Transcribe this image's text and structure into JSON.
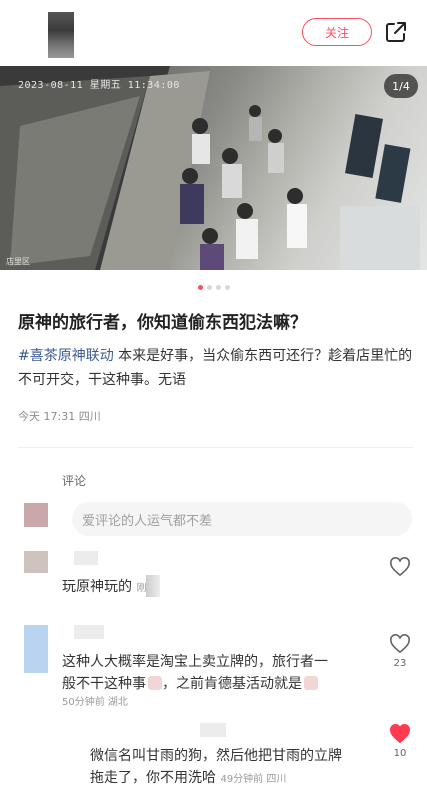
{
  "header": {
    "follow_label": "关注",
    "share_icon": "share-external-icon"
  },
  "photo": {
    "timestamp": "2023-08-11 星期五 11:34:00",
    "counter": "1/4",
    "cam_tag": "店里区",
    "dots_total": 4,
    "dots_active": 1
  },
  "post": {
    "title": "原神的旅行者，你知道偷东西犯法嘛？",
    "hashtag": "#喜茶原神联动",
    "body": " 本来是好事，当众偷东西可还行？趁着店里忙的不可开交，干这种事。无语",
    "meta": "今天 17:31 四川"
  },
  "comments": {
    "label": "评论",
    "input_placeholder": "爱评论的人运气都不差",
    "items": [
      {
        "text": "玩原神玩的",
        "suffix": "刚",
        "likes": "",
        "liked": false
      },
      {
        "text_line1": "这种人大概率是淘宝上卖立牌的，旅行者一",
        "text_line2a": "般不干这种事",
        "text_line2b": "，之前肯德基活动就是",
        "time": "50分钟前 湖北",
        "likes": "23",
        "liked": false
      },
      {
        "text_line1": "微信名叫甘雨的狗，然后他把甘雨的立牌",
        "text_line2": "拖走了，你不用洗哈",
        "time": "49分钟前 四川",
        "likes": "10",
        "liked": true
      }
    ]
  },
  "colors": {
    "accent": "#ff4c5f",
    "hashtag": "#3b5a92"
  }
}
